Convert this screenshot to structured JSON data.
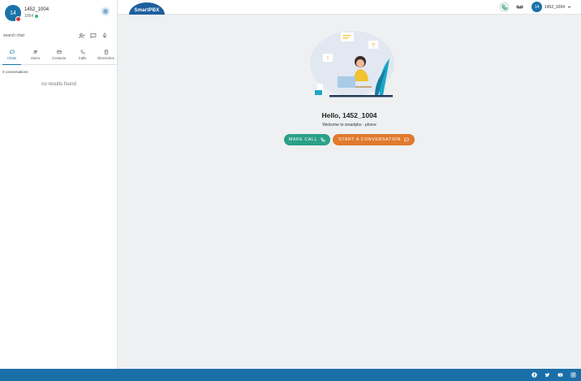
{
  "profile": {
    "avatar_initials": "14",
    "name": "1452_1004",
    "extension": "1004"
  },
  "search": {
    "placeholder": "search chat"
  },
  "tabs": [
    {
      "label": "Chats",
      "icon": "chat-icon",
      "active": true
    },
    {
      "label": "Users",
      "icon": "users-icon",
      "active": false
    },
    {
      "label": "Contacts",
      "icon": "contacts-icon",
      "active": false
    },
    {
      "label": "Calls",
      "icon": "phone-icon",
      "active": false
    },
    {
      "label": "Directories",
      "icon": "directory-icon",
      "active": false
    }
  ],
  "conversations": {
    "count_label": "0 conversations",
    "empty_label": "no results found"
  },
  "topbar": {
    "logo_text": "SmartPBX",
    "user_initials": "14",
    "user_name": "1452_1004"
  },
  "main": {
    "greeting": "Hello, 1452_1004",
    "welcome": "Welcome to smartpbx - phone",
    "make_call_label": "MAKE CALL",
    "start_conversation_label": "START A CONVERSATION"
  },
  "colors": {
    "brand": "#1a6fa8",
    "call_button": "#2aa187",
    "conversation_button": "#e07a2d",
    "online": "#2dbf6a",
    "status_badge": "#d63b3b"
  }
}
